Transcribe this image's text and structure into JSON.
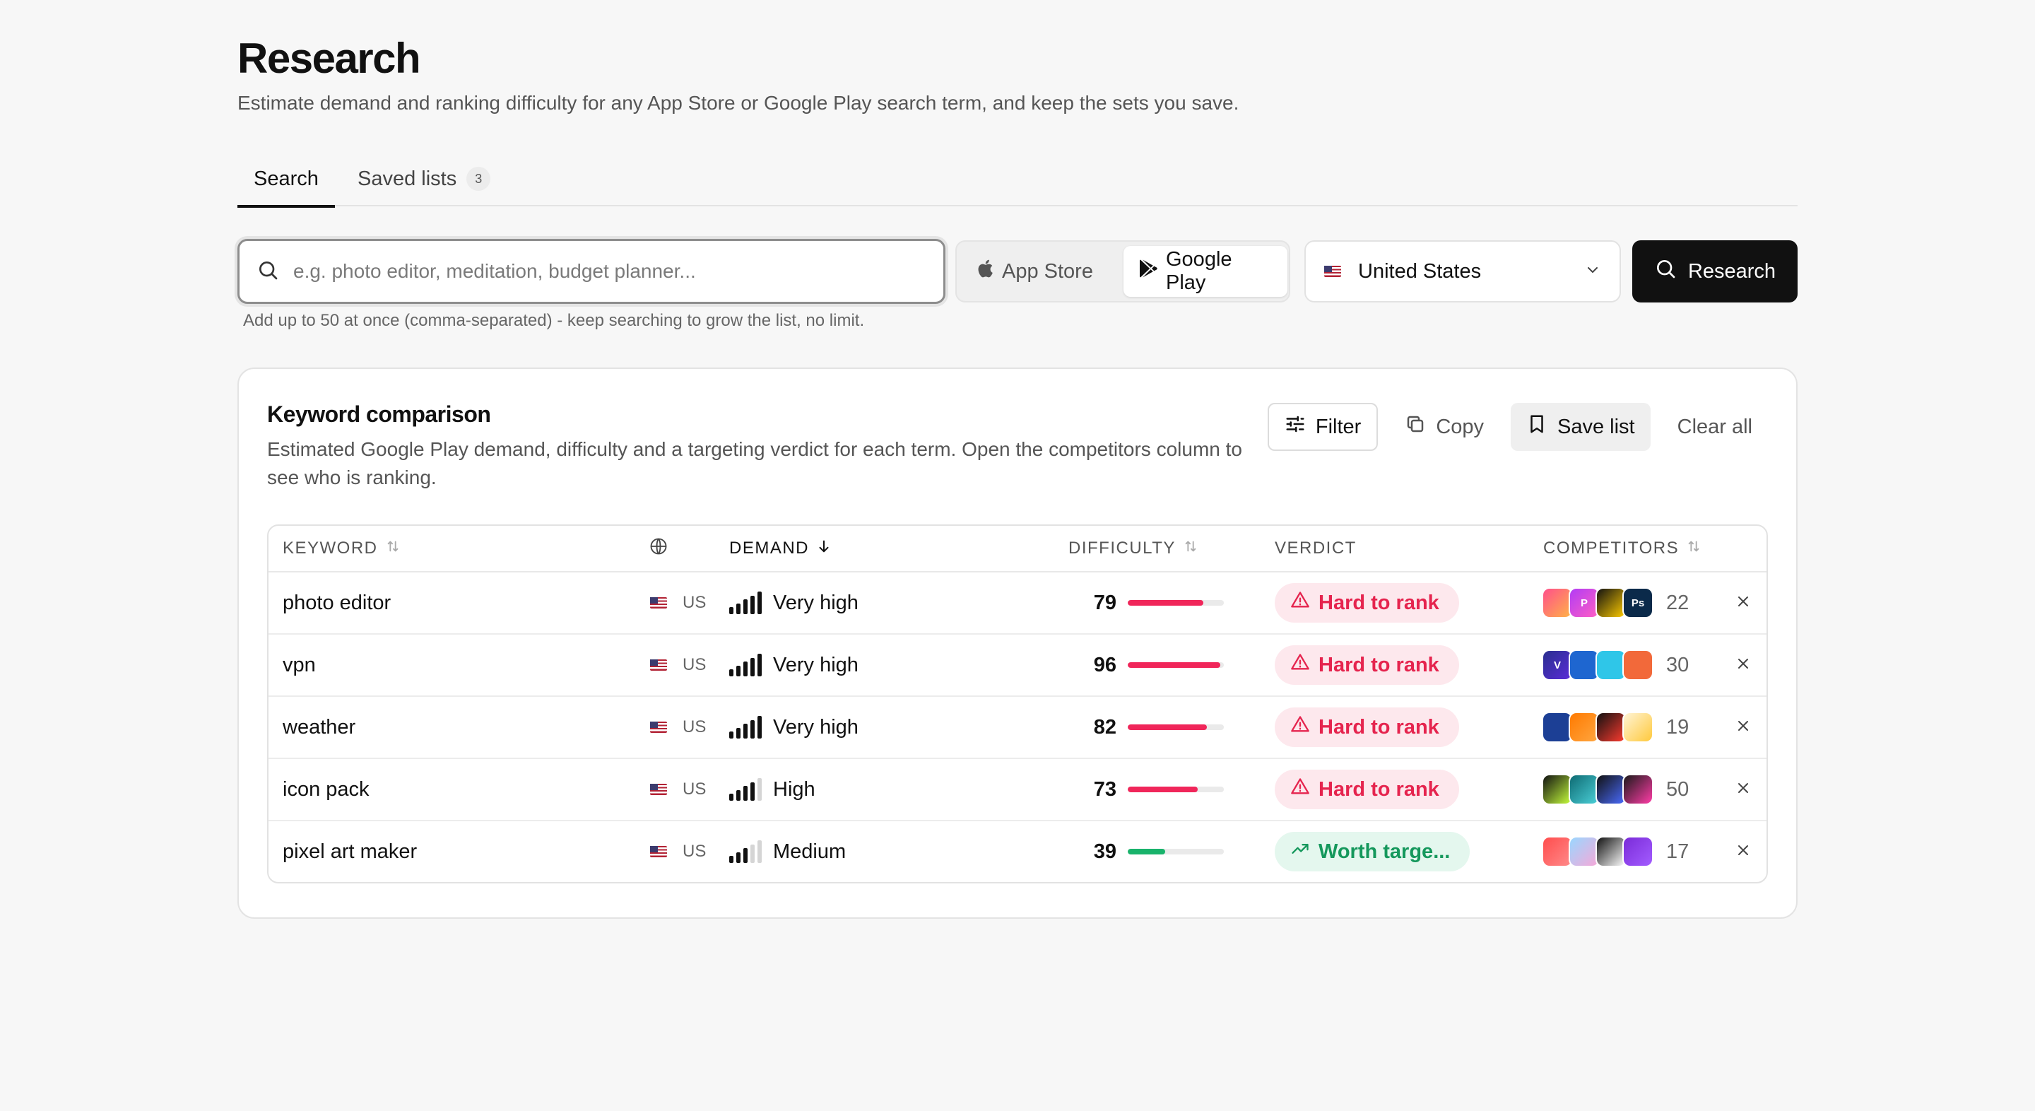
{
  "page": {
    "title": "Research",
    "subtitle": "Estimate demand and ranking difficulty for any App Store or Google Play search term, and keep the sets you save."
  },
  "tabs": [
    {
      "label": "Search",
      "active": true
    },
    {
      "label": "Saved lists",
      "badge": "3",
      "active": false
    }
  ],
  "search": {
    "placeholder": "e.g. photo editor, meditation, budget planner...",
    "value": "",
    "helper": "Add up to 50 at once (comma-separated) - keep searching to grow the list, no limit."
  },
  "store_toggle": {
    "options": [
      "App Store",
      "Google Play"
    ],
    "selected": "Google Play"
  },
  "country": {
    "label": "United States"
  },
  "research_button": "Research",
  "card": {
    "title": "Keyword comparison",
    "description": "Estimated Google Play demand, difficulty and a targeting verdict for each term. Open the competitors column to see who is ranking.",
    "actions": {
      "filter": "Filter",
      "copy": "Copy",
      "save": "Save list",
      "clear": "Clear all"
    }
  },
  "table": {
    "headers": {
      "keyword": "KEYWORD",
      "demand": "DEMAND",
      "difficulty": "DIFFICULTY",
      "verdict": "VERDICT",
      "competitors": "COMPETITORS"
    },
    "rows": [
      {
        "keyword": "photo editor",
        "country": "US",
        "demand": "Very high",
        "demand_level": 5,
        "difficulty": "79",
        "difficulty_value": 79,
        "verdict": "Hard to rank",
        "verdict_type": "hard",
        "competitors": "22",
        "icons": [
          {
            "bg": "#ff4f8b",
            "color2": "#ffb347",
            "glyph": ""
          },
          {
            "bg": "#b23cf5",
            "color2": "#ff5fc4",
            "glyph": "P"
          },
          {
            "bg": "#111111",
            "color2": "#ffcc00",
            "glyph": ""
          },
          {
            "bg": "#0b2a4a",
            "color2": "#0b2a4a",
            "glyph": "Ps"
          }
        ]
      },
      {
        "keyword": "vpn",
        "country": "US",
        "demand": "Very high",
        "demand_level": 5,
        "difficulty": "96",
        "difficulty_value": 96,
        "verdict": "Hard to rank",
        "verdict_type": "hard",
        "competitors": "30",
        "icons": [
          {
            "bg": "#2a2f8f",
            "color2": "#5b2bd8",
            "glyph": "V"
          },
          {
            "bg": "#1e66d0",
            "color2": "#1e66d0",
            "glyph": ""
          },
          {
            "bg": "#2fc6e8",
            "color2": "#2fc6e8",
            "glyph": ""
          },
          {
            "bg": "#f2693a",
            "color2": "#f2693a",
            "glyph": ""
          }
        ]
      },
      {
        "keyword": "weather",
        "country": "US",
        "demand": "Very high",
        "demand_level": 5,
        "difficulty": "82",
        "difficulty_value": 82,
        "verdict": "Hard to rank",
        "verdict_type": "hard",
        "competitors": "19",
        "icons": [
          {
            "bg": "#1c3f95",
            "color2": "#1c3f95",
            "glyph": ""
          },
          {
            "bg": "#ff7a00",
            "color2": "#ffa640",
            "glyph": ""
          },
          {
            "bg": "#111111",
            "color2": "#ff3b2f",
            "glyph": ""
          },
          {
            "bg": "#fff4d6",
            "color2": "#ffc93c",
            "glyph": ""
          }
        ]
      },
      {
        "keyword": "icon pack",
        "country": "US",
        "demand": "High",
        "demand_level": 4,
        "difficulty": "73",
        "difficulty_value": 73,
        "verdict": "Hard to rank",
        "verdict_type": "hard",
        "competitors": "50",
        "icons": [
          {
            "bg": "#111111",
            "color2": "#c7ff3c",
            "glyph": ""
          },
          {
            "bg": "#0e6b73",
            "color2": "#4bd0d8",
            "glyph": ""
          },
          {
            "bg": "#111111",
            "color2": "#4a6cff",
            "glyph": ""
          },
          {
            "bg": "#1a1a1a",
            "color2": "#ff3ca7",
            "glyph": ""
          }
        ]
      },
      {
        "keyword": "pixel art maker",
        "country": "US",
        "demand": "Medium",
        "demand_level": 3,
        "difficulty": "39",
        "difficulty_value": 39,
        "verdict": "Worth targe...",
        "verdict_type": "worth",
        "competitors": "17",
        "icons": [
          {
            "bg": "#ff4d4d",
            "color2": "#ff8a8a",
            "glyph": ""
          },
          {
            "bg": "#9ad7ff",
            "color2": "#f7a8d8",
            "glyph": ""
          },
          {
            "bg": "#111111",
            "color2": "#ffffff",
            "glyph": ""
          },
          {
            "bg": "#7a2bd8",
            "color2": "#a35cff",
            "glyph": ""
          }
        ]
      }
    ]
  },
  "colors": {
    "hard": "#f0265a",
    "worth": "#19b36b",
    "accent": "#111111"
  }
}
